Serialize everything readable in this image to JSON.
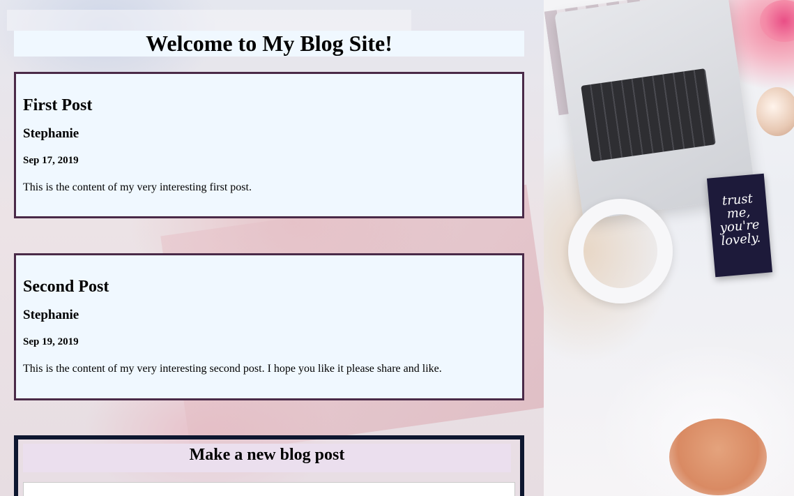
{
  "page": {
    "title": "Welcome to My Blog Site!"
  },
  "posts": [
    {
      "title": "First Post",
      "author": "Stephanie",
      "date": "Sep 17, 2019",
      "content": "This is the content of my very interesting first post."
    },
    {
      "title": "Second Post",
      "author": "Stephanie",
      "date": "Sep 19, 2019",
      "content": "This is the content of my very interesting second post. I hope you like it please share and like."
    }
  ],
  "new_post": {
    "header": "Make a new blog post",
    "title_input_value": "",
    "title_input_placeholder": ""
  },
  "background": {
    "card_text": "trust me, you're lovely."
  },
  "colors": {
    "panel": "#f0f8ff",
    "post_border": "#4a2a48",
    "form_border": "#0e1730",
    "form_header": "#ebdfee"
  }
}
